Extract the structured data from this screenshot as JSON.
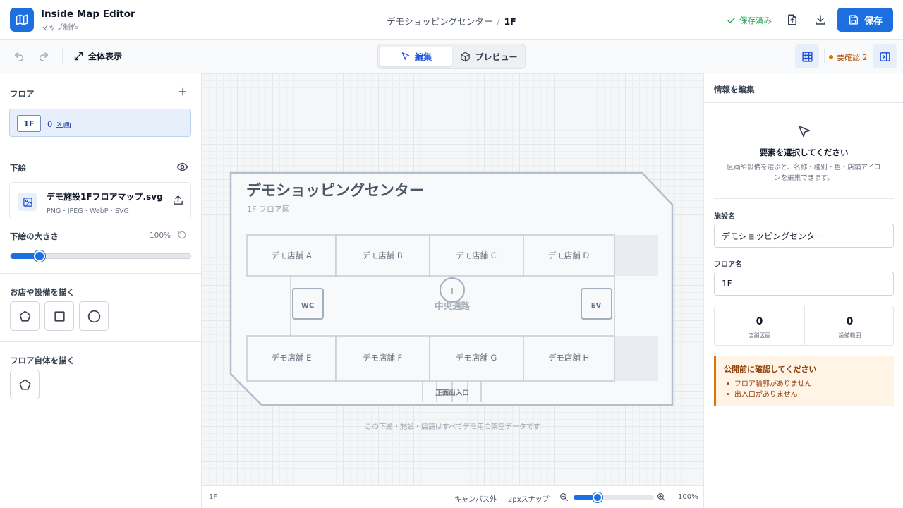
{
  "app": {
    "title": "Inside Map Editor",
    "subtitle": "マップ制作",
    "logo_icon": "map-icon",
    "accent_color": "#1d6fe0"
  },
  "breadcrumb": {
    "project": "デモショッピングセンター",
    "separator": "/",
    "floor": "1F"
  },
  "header": {
    "saved_status": "保存済み",
    "save_label": "保存"
  },
  "toolbar": {
    "fit_label": "全体表示",
    "mode_edit": "編集",
    "mode_preview": "プレビュー",
    "pending_label": "要確認 2"
  },
  "sidebar": {
    "floor_section": {
      "title": "フロア",
      "items": [
        {
          "badge": "1F",
          "count": "0 区画"
        }
      ]
    },
    "underlay": {
      "title": "下絵",
      "file_name": "デモ施設1Fフロアマップ.svg",
      "file_types": "PNG・JPEG・WebP・SVG",
      "size_label": "下絵の大きさ",
      "size_value": "100%",
      "size_fraction": 0.16
    },
    "draw_shops": {
      "title": "お店や設備を描く",
      "tools": [
        "polygon-tool",
        "rectangle-tool",
        "circle-tool"
      ]
    },
    "draw_floor": {
      "title": "フロア自体を描く",
      "tools": [
        "floor-polygon-tool"
      ]
    }
  },
  "canvas": {
    "map": {
      "title": "デモショッピングセンター",
      "subtitle": "1F フロア図",
      "shops_top": [
        "デモ店舗 A",
        "デモ店舗 B",
        "デモ店舗 C",
        "デモ店舗 D"
      ],
      "shops_bottom": [
        "デモ店舗 E",
        "デモ店舗 F",
        "デモ店舗 G",
        "デモ店舗 H"
      ],
      "corridor": "中央通路",
      "wc": "WC",
      "ev": "EV",
      "info": "i",
      "entrance": "正面出入口"
    },
    "footnote": "この下絵・施設・店舗はすべてデモ用の架空データです"
  },
  "status_bar": {
    "floor": "1F",
    "out_of_canvas": "キャンバス外",
    "snap": "2pxスナップ",
    "zoom": "100%",
    "zoom_fraction": 0.3
  },
  "inspector": {
    "title": "情報を編集",
    "empty_title": "要素を選択してください",
    "empty_desc": "区画や設備を選ぶと、名称・種別・色・店舗アイコンを編集できます。",
    "facility_label": "施設名",
    "facility_value": "デモショッピングセンター",
    "floor_label": "フロア名",
    "floor_value": "1F",
    "stats": [
      {
        "value": "0",
        "label": "店舗区画"
      },
      {
        "value": "0",
        "label": "設備範囲"
      }
    ],
    "warning": {
      "title": "公開前に確認してください",
      "items": [
        "フロア輪郭がありません",
        "出入口がありません"
      ]
    }
  }
}
